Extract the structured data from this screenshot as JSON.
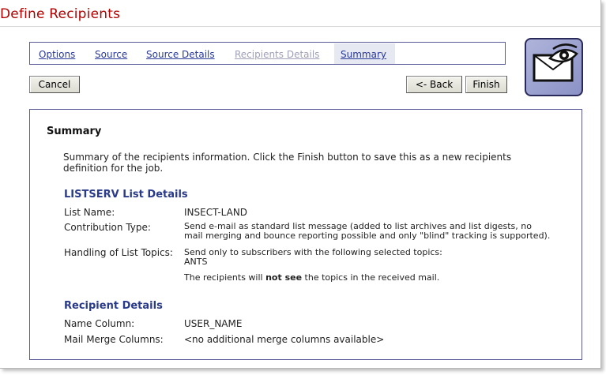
{
  "header": {
    "title": "Define Recipients"
  },
  "tabs": [
    {
      "label": "Options",
      "state": "link"
    },
    {
      "label": "Source",
      "state": "link"
    },
    {
      "label": "Source Details",
      "state": "link"
    },
    {
      "label": "Recipients Details",
      "state": "disabled"
    },
    {
      "label": "Summary",
      "state": "active"
    }
  ],
  "buttons": {
    "cancel": "Cancel",
    "back": "<- Back",
    "finish": "Finish"
  },
  "icon": "eye-envelope-icon",
  "summary": {
    "heading": "Summary",
    "description": "Summary of the recipients information. Click the Finish button to save this as a new recipients definition for the job.",
    "list_details": {
      "heading": "LISTSERV List Details",
      "list_name_label": "List Name:",
      "list_name_value": "INSECT-LAND",
      "contribution_label": "Contribution Type:",
      "contribution_line1": "Send e-mail as standard list message (added to list archives and list digests, no",
      "contribution_line2": "mail merging and bounce reporting possible and only \"blind\" tracking is supported).",
      "topics_label": "Handling of List Topics:",
      "topics_line1": "Send only to subscribers with the following selected topics:",
      "topics_value": "ANTS",
      "topics_note_pre": "The recipients will ",
      "topics_note_bold": "not see",
      "topics_note_post": " the topics in the received mail."
    },
    "recipient_details": {
      "heading": "Recipient Details",
      "name_column_label": "Name Column:",
      "name_column_value": "USER_NAME",
      "merge_columns_label": "Mail Merge Columns:",
      "merge_columns_value": "<no additional merge columns available>"
    }
  }
}
